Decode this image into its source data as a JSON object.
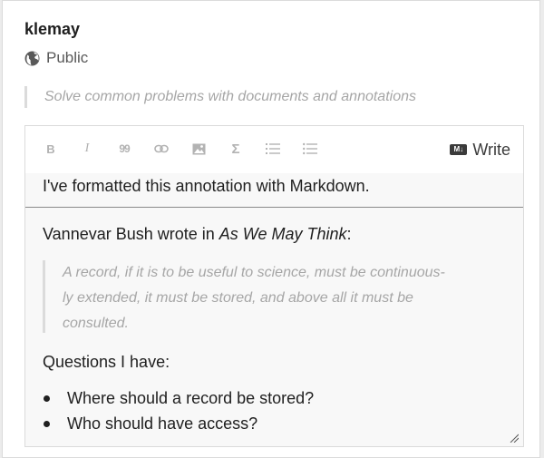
{
  "annotation": {
    "username": "klemay",
    "group": {
      "label": "Public",
      "icon": "globe-icon"
    },
    "target_quote": "Solve common problems with documents and annotations"
  },
  "editor": {
    "toolbar": {
      "buttons": [
        {
          "name": "bold",
          "glyph": "B",
          "icon": "bold-icon"
        },
        {
          "name": "italic",
          "glyph": "I",
          "icon": "italic-icon"
        },
        {
          "name": "quote",
          "glyph": "99",
          "icon": "quote-icon"
        },
        {
          "name": "link",
          "icon": "link-icon"
        },
        {
          "name": "image",
          "icon": "image-icon"
        },
        {
          "name": "math",
          "glyph": "Σ",
          "icon": "math-icon"
        },
        {
          "name": "numbered-list",
          "icon": "numbered-list-icon"
        },
        {
          "name": "list",
          "icon": "bullet-list-icon"
        }
      ],
      "write_label": "Write",
      "markdown_badge": "M↓"
    },
    "content": {
      "first_line": "I've formatted this annotation with Markdown.",
      "intro_text": "Vannevar Bush wrote in ",
      "intro_em": "As We May Think",
      "intro_end": ":",
      "blockquote_lines": [
        "A record, if it is to be useful to science, must be continuous-",
        "ly extended, it must be stored, and above all it must be",
        "consulted."
      ],
      "questions_heading": "Questions I have:",
      "list_items": [
        "Where should a record be stored?",
        "Who should have access?"
      ]
    }
  },
  "colors": {
    "text": "#202020",
    "muted": "#a6a6a6",
    "border": "#dbdbdb",
    "editor_bg": "#f8f8f8"
  }
}
